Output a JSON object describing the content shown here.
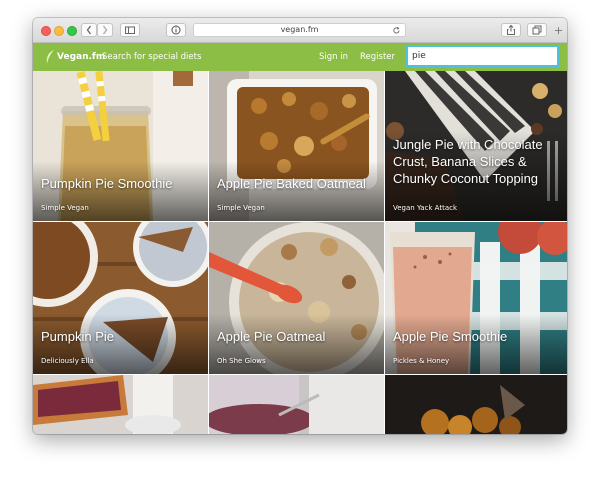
{
  "browser": {
    "url": "vegan.fm",
    "info_icon": "info-icon",
    "icons": [
      "back-icon",
      "forward-icon",
      "sidebar-icon",
      "reload-icon",
      "share-icon",
      "tabs-icon",
      "new-tab-icon"
    ],
    "new_tab_label": "+"
  },
  "site": {
    "brand": "Vegan.fm",
    "search_diets_label": "Search for special diets",
    "sign_in_label": "Sign in",
    "register_label": "Register",
    "search_value": "pie",
    "accent_green": "#8cbd45",
    "search_border": "#4fc1e0"
  },
  "recipes": [
    {
      "title": "Pumpkin Pie Smoothie",
      "source": "Simple Vegan"
    },
    {
      "title": "Apple Pie Baked Oatmeal",
      "source": "Simple Vegan"
    },
    {
      "title": "Jungle Pie with Chocolate Crust, Banana Slices & Chunky Coconut Topping",
      "source": "Vegan Yack Attack"
    },
    {
      "title": "Pumpkin Pie",
      "source": "Deliciously Ella"
    },
    {
      "title": "Apple Pie Oatmeal",
      "source": "Oh She Glows"
    },
    {
      "title": "Apple Pie Smoothie",
      "source": "Pickles & Honey"
    }
  ]
}
